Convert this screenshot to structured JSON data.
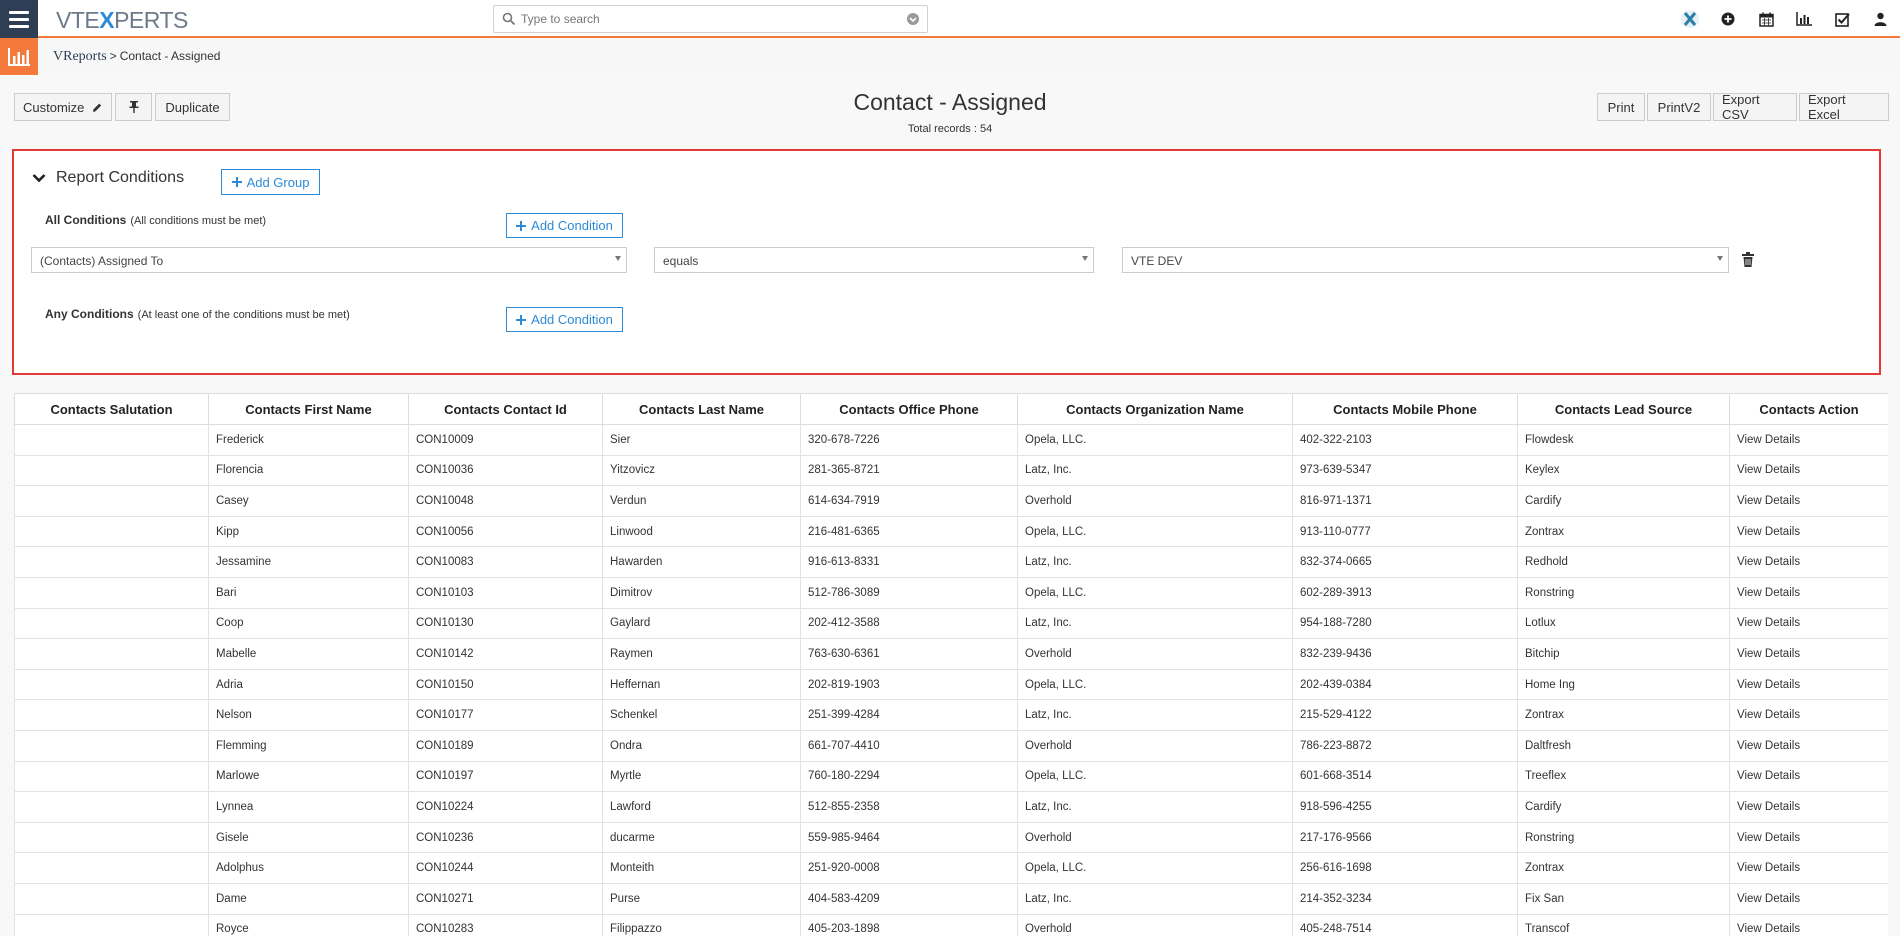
{
  "header": {
    "logo_prefix": "VTE",
    "logo_x": "X",
    "logo_suffix": "PERTS",
    "search_placeholder": "Type to search",
    "icons": [
      "vtexperts-logo-icon",
      "plus-circle-icon",
      "calendar-icon",
      "chart-icon",
      "checkbox-icon",
      "user-icon"
    ]
  },
  "breadcrumb": {
    "module": "VReports",
    "separator": ">",
    "page": "Contact - Assigned"
  },
  "toolbar": {
    "customize": "Customize",
    "duplicate": "Duplicate",
    "print": "Print",
    "printv2": "PrintV2",
    "export_csv": "Export CSV",
    "export_excel": "Export Excel"
  },
  "report": {
    "title": "Contact - Assigned",
    "total_records": "Total records : 54"
  },
  "conditions": {
    "heading": "Report Conditions",
    "add_group": "Add Group",
    "all_label": "All Conditions",
    "all_hint": "(All conditions must be met)",
    "any_label": "Any Conditions",
    "any_hint": "(At least one of the conditions must be met)",
    "add_condition": "Add Condition",
    "field": "(Contacts) Assigned To",
    "operator": "equals",
    "value": "VTE DEV"
  },
  "table": {
    "columns": [
      "Contacts Salutation",
      "Contacts First Name",
      "Contacts Contact Id",
      "Contacts Last Name",
      "Contacts Office Phone",
      "Contacts Organization Name",
      "Contacts Mobile Phone",
      "Contacts Lead Source",
      "Contacts Action"
    ],
    "rows": [
      [
        "",
        "Frederick",
        "CON10009",
        "Sier",
        "320-678-7226",
        "Opela, LLC.",
        "402-322-2103",
        "Flowdesk",
        "View Details"
      ],
      [
        "",
        "Florencia",
        "CON10036",
        "Yitzovicz",
        "281-365-8721",
        "Latz, Inc.",
        "973-639-5347",
        "Keylex",
        "View Details"
      ],
      [
        "",
        "Casey",
        "CON10048",
        "Verdun",
        "614-634-7919",
        "Overhold",
        "816-971-1371",
        "Cardify",
        "View Details"
      ],
      [
        "",
        "Kipp",
        "CON10056",
        "Linwood",
        "216-481-6365",
        "Opela, LLC.",
        "913-110-0777",
        "Zontrax",
        "View Details"
      ],
      [
        "",
        "Jessamine",
        "CON10083",
        "Hawarden",
        "916-613-8331",
        "Latz, Inc.",
        "832-374-0665",
        "Redhold",
        "View Details"
      ],
      [
        "",
        "Bari",
        "CON10103",
        "Dimitrov",
        "512-786-3089",
        "Opela, LLC.",
        "602-289-3913",
        "Ronstring",
        "View Details"
      ],
      [
        "",
        "Coop",
        "CON10130",
        "Gaylard",
        "202-412-3588",
        "Latz, Inc.",
        "954-188-7280",
        "Lotlux",
        "View Details"
      ],
      [
        "",
        "Mabelle",
        "CON10142",
        "Raymen",
        "763-630-6361",
        "Overhold",
        "832-239-9436",
        "Bitchip",
        "View Details"
      ],
      [
        "",
        "Adria",
        "CON10150",
        "Heffernan",
        "202-819-1903",
        "Opela, LLC.",
        "202-439-0384",
        "Home Ing",
        "View Details"
      ],
      [
        "",
        "Nelson",
        "CON10177",
        "Schenkel",
        "251-399-4284",
        "Latz, Inc.",
        "215-529-4122",
        "Zontrax",
        "View Details"
      ],
      [
        "",
        "Flemming",
        "CON10189",
        "Ondra",
        "661-707-4410",
        "Overhold",
        "786-223-8872",
        "Daltfresh",
        "View Details"
      ],
      [
        "",
        "Marlowe",
        "CON10197",
        "Myrtle",
        "760-180-2294",
        "Opela, LLC.",
        "601-668-3514",
        "Treeflex",
        "View Details"
      ],
      [
        "",
        "Lynnea",
        "CON10224",
        "Lawford",
        "512-855-2358",
        "Latz, Inc.",
        "918-596-4255",
        "Cardify",
        "View Details"
      ],
      [
        "",
        "Gisele",
        "CON10236",
        "ducarme",
        "559-985-9464",
        "Overhold",
        "217-176-9566",
        "Ronstring",
        "View Details"
      ],
      [
        "",
        "Adolphus",
        "CON10244",
        "Monteith",
        "251-920-0008",
        "Opela, LLC.",
        "256-616-1698",
        "Zontrax",
        "View Details"
      ],
      [
        "",
        "Dame",
        "CON10271",
        "Purse",
        "404-583-4209",
        "Latz, Inc.",
        "214-352-3234",
        "Fix San",
        "View Details"
      ],
      [
        "",
        "Royce",
        "CON10283",
        "Filippazzo",
        "405-203-1898",
        "Overhold",
        "405-248-7514",
        "Transcof",
        "View Details"
      ]
    ]
  },
  "colors": {
    "accent_orange": "#f47a3c",
    "nav_dark": "#2e3e55",
    "link_blue": "#2c8ad6",
    "conditions_border": "#e53935"
  }
}
